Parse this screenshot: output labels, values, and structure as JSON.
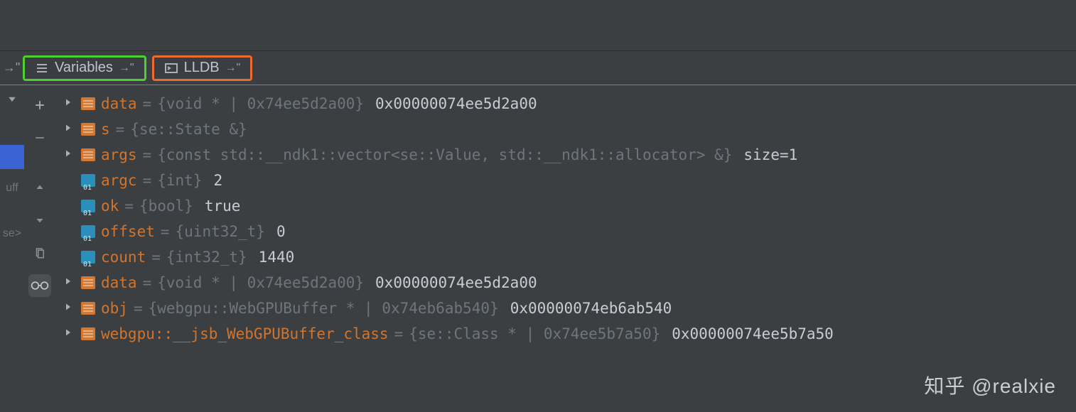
{
  "tabs": {
    "variables": {
      "label": "Variables"
    },
    "lldb": {
      "label": "LLDB"
    }
  },
  "leftcol": {
    "label_top": "uff",
    "label_bottom": "se>"
  },
  "vars": [
    {
      "expand": true,
      "kind": "struct",
      "name": "data",
      "type": "{void * | 0x74ee5d2a00}",
      "value": "0x00000074ee5d2a00"
    },
    {
      "expand": true,
      "kind": "struct",
      "name": "s",
      "type": "{se::State &}",
      "value": ""
    },
    {
      "expand": true,
      "kind": "struct",
      "name": "args",
      "type": "{const std::__ndk1::vector<se::Value, std::__ndk1::allocator> &}",
      "value": "size=1"
    },
    {
      "expand": false,
      "kind": "prim",
      "name": "argc",
      "type": "{int}",
      "value": "2"
    },
    {
      "expand": false,
      "kind": "prim",
      "name": "ok",
      "type": "{bool}",
      "value": "true"
    },
    {
      "expand": false,
      "kind": "prim",
      "name": "offset",
      "type": "{uint32_t}",
      "value": "0"
    },
    {
      "expand": false,
      "kind": "prim",
      "name": "count",
      "type": "{int32_t}",
      "value": "1440"
    },
    {
      "expand": true,
      "kind": "struct",
      "name": "data",
      "type": "{void * | 0x74ee5d2a00}",
      "value": "0x00000074ee5d2a00"
    },
    {
      "expand": true,
      "kind": "struct",
      "name": "obj",
      "type": "{webgpu::WebGPUBuffer * | 0x74eb6ab540}",
      "value": "0x00000074eb6ab540"
    },
    {
      "expand": true,
      "kind": "struct",
      "name": "webgpu::__jsb_WebGPUBuffer_class",
      "type": "{se::Class * | 0x74ee5b7a50}",
      "value": "0x00000074ee5b7a50"
    }
  ],
  "watermark": "知乎 @realxie"
}
